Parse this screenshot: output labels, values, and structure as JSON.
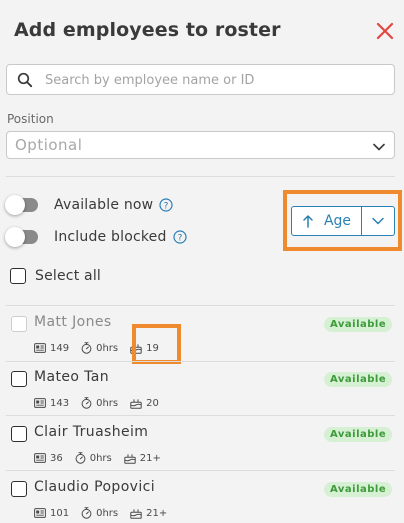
{
  "header": {
    "title": "Add employees to roster"
  },
  "search": {
    "placeholder": "Search by employee name or ID",
    "value": ""
  },
  "position": {
    "label": "Position",
    "value": "Optional"
  },
  "toggles": [
    {
      "label": "Available now",
      "on": false
    },
    {
      "label": "Include blocked",
      "on": false
    }
  ],
  "sort": {
    "label": "Age",
    "direction": "ascending"
  },
  "select_all": {
    "label": "Select all",
    "checked": false
  },
  "employees": [
    {
      "name": "Matt Jones",
      "status": "Available",
      "id_count": "149",
      "hours": "0hrs",
      "age": "19",
      "disabled": true
    },
    {
      "name": "Mateo Tan",
      "status": "Available",
      "id_count": "143",
      "hours": "0hrs",
      "age": "20",
      "disabled": false
    },
    {
      "name": "Clair Truasheim",
      "status": "Available",
      "id_count": "36",
      "hours": "0hrs",
      "age": "21+",
      "disabled": false
    },
    {
      "name": "Claudio Popovici",
      "status": "Available",
      "id_count": "101",
      "hours": "0hrs",
      "age": "21+",
      "disabled": false
    }
  ],
  "colors": {
    "accent": "#2a7fb3",
    "close": "#e2463f",
    "highlight": "#ef8a2e",
    "badge_bg": "#d6f0d4",
    "badge_text": "#3e9a3a"
  },
  "icons": {
    "search": "search-icon",
    "close": "close-icon",
    "chevron": "chevron-down-icon",
    "info": "info-icon",
    "sort": "arrow-up-icon",
    "id": "id-card-icon",
    "hours": "stopwatch-icon",
    "age": "cake-icon"
  }
}
